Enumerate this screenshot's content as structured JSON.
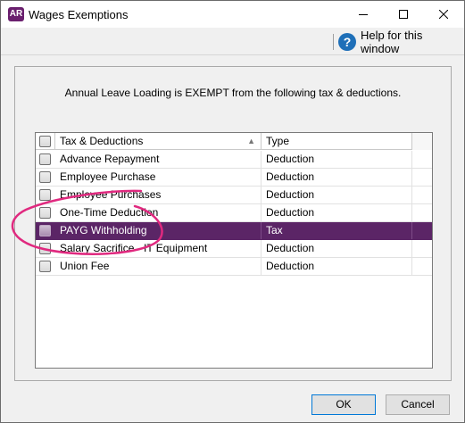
{
  "window": {
    "app_icon_text": "AR",
    "title": "Wages Exemptions",
    "accent": "#6a1f6e"
  },
  "helpbar": {
    "help_icon": "question-mark-icon",
    "help_label": "Help for this window"
  },
  "panel": {
    "message": "Annual Leave Loading is EXEMPT from the following tax & deductions."
  },
  "grid": {
    "columns": [
      "Tax & Deductions",
      "Type"
    ],
    "sort_indicator": "▲",
    "selected_color": "#5b2566",
    "rows": [
      {
        "name": "Advance Repayment",
        "type": "Deduction",
        "checked": false,
        "selected": false
      },
      {
        "name": "Employee Purchase",
        "type": "Deduction",
        "checked": false,
        "selected": false
      },
      {
        "name": "Employee Purchases",
        "type": "Deduction",
        "checked": false,
        "selected": false
      },
      {
        "name": "One-Time Deduction",
        "type": "Deduction",
        "checked": false,
        "selected": false
      },
      {
        "name": "PAYG Withholding",
        "type": "Tax",
        "checked": false,
        "selected": true
      },
      {
        "name": "Salary Sacrifice - IT Equipment",
        "type": "Deduction",
        "checked": false,
        "selected": false
      },
      {
        "name": "Union Fee",
        "type": "Deduction",
        "checked": false,
        "selected": false
      }
    ]
  },
  "buttons": {
    "ok": "OK",
    "cancel": "Cancel"
  },
  "annotation": {
    "color": "#e0297f"
  }
}
